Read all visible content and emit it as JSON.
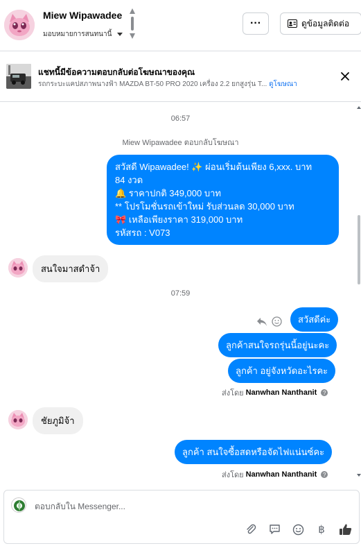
{
  "header": {
    "name": "Miew Wipawadee",
    "assign_label": "มอบหมายการสนทนานี้",
    "more_label": "···",
    "info_label": "ดูข้อมูลติดต่อ"
  },
  "ad": {
    "title": "แชทนี้มีข้อความตอบกลับต่อโฆษณาของคุณ",
    "subtitle": "รถกระบะแคปสภาพนางฟ้า MAZDA BT-50 PRO 2020 เครื่อง 2.2 ยกสูงรุ่น T...",
    "link": "ดูโฆษณา"
  },
  "chat": {
    "time1": "06:57",
    "ad_reply_note": "Miew Wipawadee ตอบกลับโฆษณา",
    "ad_message_lines": [
      "สวัสดี Wipawadee! ✨  ผ่อนเริ่มต้นเพียง 6,xxx. บาท",
      "84 งวด",
      "🔔 ราคาปกติ 349,000 บาท",
      "** โปรโมชั่นรถเข้าใหม่ รับส่วนลด 30,000 บาท",
      "🎀  เหลือเพียงราคา 319,000 บาท",
      " รหัสรถ : V073"
    ],
    "in_msg1": "สนใจมาสดำจ้า",
    "time2": "07:59",
    "out_msg1": "สวัสดีค่ะ",
    "out_msg2": "ลูกค้าสนใจรถรุ่นนี้อยู่นะคะ",
    "out_msg3": "ลูกค้า อยู่จังหวัดอะไรคะ",
    "sent_by_label": "ส่งโดย",
    "sent_by_name": "Nanwhan Nanthanit",
    "in_msg2": "ชัยภูมิจ้า",
    "out_msg4": "ลูกค้า สนใจซื้อสดหรือจัดไฟแน่นซ์คะ"
  },
  "composer": {
    "placeholder": "ตอบกลับใน Messenger...",
    "tools": [
      "paperclip-icon",
      "message-template-icon",
      "emoji-icon",
      "baht-icon",
      "thumbs-up-icon"
    ]
  }
}
